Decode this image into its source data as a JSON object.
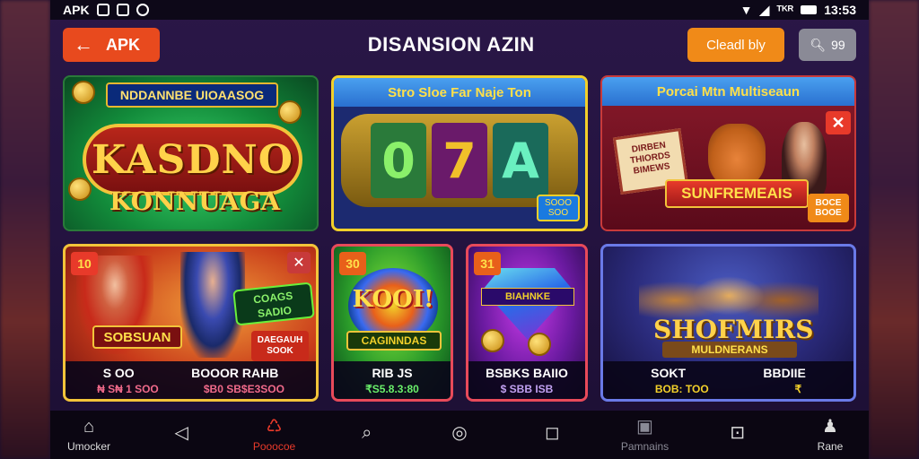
{
  "status_bar": {
    "left_label": "APK",
    "icons": [
      "clipboard-icon",
      "camera-icon",
      "sync-icon"
    ],
    "right_text": "13:53",
    "signal_label": "ᵀᴷᴿ"
  },
  "header": {
    "back_label": "APK",
    "title": "DISANSION AZIN",
    "check_label": "Cleadl bly",
    "search_label": "99"
  },
  "cards": {
    "c1": {
      "tag": "NDDANNBE UIOAASOG",
      "logo_main": "KASDNO",
      "logo_sub": "KONNUAGA"
    },
    "c2": {
      "title": "Stro Sloe Far Naje Ton",
      "reels": [
        "0",
        "7",
        "A"
      ],
      "badge": "SOOO SOO"
    },
    "c3": {
      "title": "Porcai Mtn Multiseaun",
      "close": "✕",
      "sign": "DIRBEN THIORDS BIMEWS",
      "banner": "SUNFREMEAIS",
      "badge": "BOCE BOOE"
    },
    "c4": {
      "num": "10",
      "close": "✕",
      "brand": "SOBSUAN",
      "logo2": "COAGS SADIO",
      "promo": "DAEGAUH SOOK",
      "info_left": "S OO",
      "info_right": "BOOOR RAHB",
      "sub_left": "₦ S₦ 1 SOO",
      "sub_right": "$B0 SB$E3SOO"
    },
    "c5": {
      "num": "30",
      "logo": "KOOI!",
      "sub_logo": "CAGINNDAS",
      "info": "RIB JS",
      "sub": "₹S5.8.3:80"
    },
    "c6": {
      "num": "31",
      "gem_label": "BIAHNKE",
      "info": "BSBKS BAIIO",
      "sub": "$ SBB ISB"
    },
    "c7": {
      "title": "SHOFMIRS",
      "subtitle": "MULDNERANS",
      "info_left": "SOKT",
      "info_right": "BBDIIE",
      "sub_left": "BOB: TOO",
      "sub_right": "₹"
    }
  },
  "bottom_nav": [
    {
      "label": "Umocker",
      "icon": "home-icon",
      "glyph": "⌂"
    },
    {
      "label": "",
      "icon": "back-icon",
      "glyph": "◁"
    },
    {
      "label": "Pooocoe",
      "icon": "chat-icon",
      "glyph": "♺"
    },
    {
      "label": "",
      "icon": "search-icon",
      "glyph": "⌕"
    },
    {
      "label": "",
      "icon": "circle-icon",
      "glyph": "◎"
    },
    {
      "label": "",
      "icon": "square-icon",
      "glyph": "◻"
    },
    {
      "label": "Pamnains",
      "icon": "gift-icon",
      "glyph": "▣"
    },
    {
      "label": "",
      "icon": "wallet-icon",
      "glyph": "⊡"
    },
    {
      "label": "Rane",
      "icon": "user-icon",
      "glyph": "♟"
    }
  ]
}
